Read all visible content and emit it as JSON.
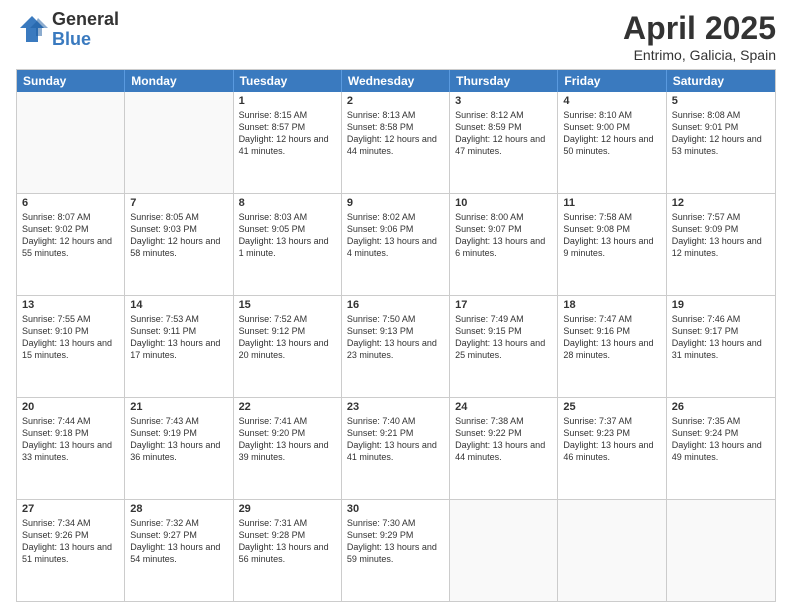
{
  "logo": {
    "general": "General",
    "blue": "Blue"
  },
  "title": {
    "month": "April 2025",
    "location": "Entrimo, Galicia, Spain"
  },
  "header_days": [
    "Sunday",
    "Monday",
    "Tuesday",
    "Wednesday",
    "Thursday",
    "Friday",
    "Saturday"
  ],
  "weeks": [
    [
      {
        "day": "",
        "empty": true
      },
      {
        "day": "",
        "empty": true
      },
      {
        "day": "1",
        "sunrise": "Sunrise: 8:15 AM",
        "sunset": "Sunset: 8:57 PM",
        "daylight": "Daylight: 12 hours and 41 minutes."
      },
      {
        "day": "2",
        "sunrise": "Sunrise: 8:13 AM",
        "sunset": "Sunset: 8:58 PM",
        "daylight": "Daylight: 12 hours and 44 minutes."
      },
      {
        "day": "3",
        "sunrise": "Sunrise: 8:12 AM",
        "sunset": "Sunset: 8:59 PM",
        "daylight": "Daylight: 12 hours and 47 minutes."
      },
      {
        "day": "4",
        "sunrise": "Sunrise: 8:10 AM",
        "sunset": "Sunset: 9:00 PM",
        "daylight": "Daylight: 12 hours and 50 minutes."
      },
      {
        "day": "5",
        "sunrise": "Sunrise: 8:08 AM",
        "sunset": "Sunset: 9:01 PM",
        "daylight": "Daylight: 12 hours and 53 minutes."
      }
    ],
    [
      {
        "day": "6",
        "sunrise": "Sunrise: 8:07 AM",
        "sunset": "Sunset: 9:02 PM",
        "daylight": "Daylight: 12 hours and 55 minutes."
      },
      {
        "day": "7",
        "sunrise": "Sunrise: 8:05 AM",
        "sunset": "Sunset: 9:03 PM",
        "daylight": "Daylight: 12 hours and 58 minutes."
      },
      {
        "day": "8",
        "sunrise": "Sunrise: 8:03 AM",
        "sunset": "Sunset: 9:05 PM",
        "daylight": "Daylight: 13 hours and 1 minute."
      },
      {
        "day": "9",
        "sunrise": "Sunrise: 8:02 AM",
        "sunset": "Sunset: 9:06 PM",
        "daylight": "Daylight: 13 hours and 4 minutes."
      },
      {
        "day": "10",
        "sunrise": "Sunrise: 8:00 AM",
        "sunset": "Sunset: 9:07 PM",
        "daylight": "Daylight: 13 hours and 6 minutes."
      },
      {
        "day": "11",
        "sunrise": "Sunrise: 7:58 AM",
        "sunset": "Sunset: 9:08 PM",
        "daylight": "Daylight: 13 hours and 9 minutes."
      },
      {
        "day": "12",
        "sunrise": "Sunrise: 7:57 AM",
        "sunset": "Sunset: 9:09 PM",
        "daylight": "Daylight: 13 hours and 12 minutes."
      }
    ],
    [
      {
        "day": "13",
        "sunrise": "Sunrise: 7:55 AM",
        "sunset": "Sunset: 9:10 PM",
        "daylight": "Daylight: 13 hours and 15 minutes."
      },
      {
        "day": "14",
        "sunrise": "Sunrise: 7:53 AM",
        "sunset": "Sunset: 9:11 PM",
        "daylight": "Daylight: 13 hours and 17 minutes."
      },
      {
        "day": "15",
        "sunrise": "Sunrise: 7:52 AM",
        "sunset": "Sunset: 9:12 PM",
        "daylight": "Daylight: 13 hours and 20 minutes."
      },
      {
        "day": "16",
        "sunrise": "Sunrise: 7:50 AM",
        "sunset": "Sunset: 9:13 PM",
        "daylight": "Daylight: 13 hours and 23 minutes."
      },
      {
        "day": "17",
        "sunrise": "Sunrise: 7:49 AM",
        "sunset": "Sunset: 9:15 PM",
        "daylight": "Daylight: 13 hours and 25 minutes."
      },
      {
        "day": "18",
        "sunrise": "Sunrise: 7:47 AM",
        "sunset": "Sunset: 9:16 PM",
        "daylight": "Daylight: 13 hours and 28 minutes."
      },
      {
        "day": "19",
        "sunrise": "Sunrise: 7:46 AM",
        "sunset": "Sunset: 9:17 PM",
        "daylight": "Daylight: 13 hours and 31 minutes."
      }
    ],
    [
      {
        "day": "20",
        "sunrise": "Sunrise: 7:44 AM",
        "sunset": "Sunset: 9:18 PM",
        "daylight": "Daylight: 13 hours and 33 minutes."
      },
      {
        "day": "21",
        "sunrise": "Sunrise: 7:43 AM",
        "sunset": "Sunset: 9:19 PM",
        "daylight": "Daylight: 13 hours and 36 minutes."
      },
      {
        "day": "22",
        "sunrise": "Sunrise: 7:41 AM",
        "sunset": "Sunset: 9:20 PM",
        "daylight": "Daylight: 13 hours and 39 minutes."
      },
      {
        "day": "23",
        "sunrise": "Sunrise: 7:40 AM",
        "sunset": "Sunset: 9:21 PM",
        "daylight": "Daylight: 13 hours and 41 minutes."
      },
      {
        "day": "24",
        "sunrise": "Sunrise: 7:38 AM",
        "sunset": "Sunset: 9:22 PM",
        "daylight": "Daylight: 13 hours and 44 minutes."
      },
      {
        "day": "25",
        "sunrise": "Sunrise: 7:37 AM",
        "sunset": "Sunset: 9:23 PM",
        "daylight": "Daylight: 13 hours and 46 minutes."
      },
      {
        "day": "26",
        "sunrise": "Sunrise: 7:35 AM",
        "sunset": "Sunset: 9:24 PM",
        "daylight": "Daylight: 13 hours and 49 minutes."
      }
    ],
    [
      {
        "day": "27",
        "sunrise": "Sunrise: 7:34 AM",
        "sunset": "Sunset: 9:26 PM",
        "daylight": "Daylight: 13 hours and 51 minutes."
      },
      {
        "day": "28",
        "sunrise": "Sunrise: 7:32 AM",
        "sunset": "Sunset: 9:27 PM",
        "daylight": "Daylight: 13 hours and 54 minutes."
      },
      {
        "day": "29",
        "sunrise": "Sunrise: 7:31 AM",
        "sunset": "Sunset: 9:28 PM",
        "daylight": "Daylight: 13 hours and 56 minutes."
      },
      {
        "day": "30",
        "sunrise": "Sunrise: 7:30 AM",
        "sunset": "Sunset: 9:29 PM",
        "daylight": "Daylight: 13 hours and 59 minutes."
      },
      {
        "day": "",
        "empty": true
      },
      {
        "day": "",
        "empty": true
      },
      {
        "day": "",
        "empty": true
      }
    ]
  ]
}
